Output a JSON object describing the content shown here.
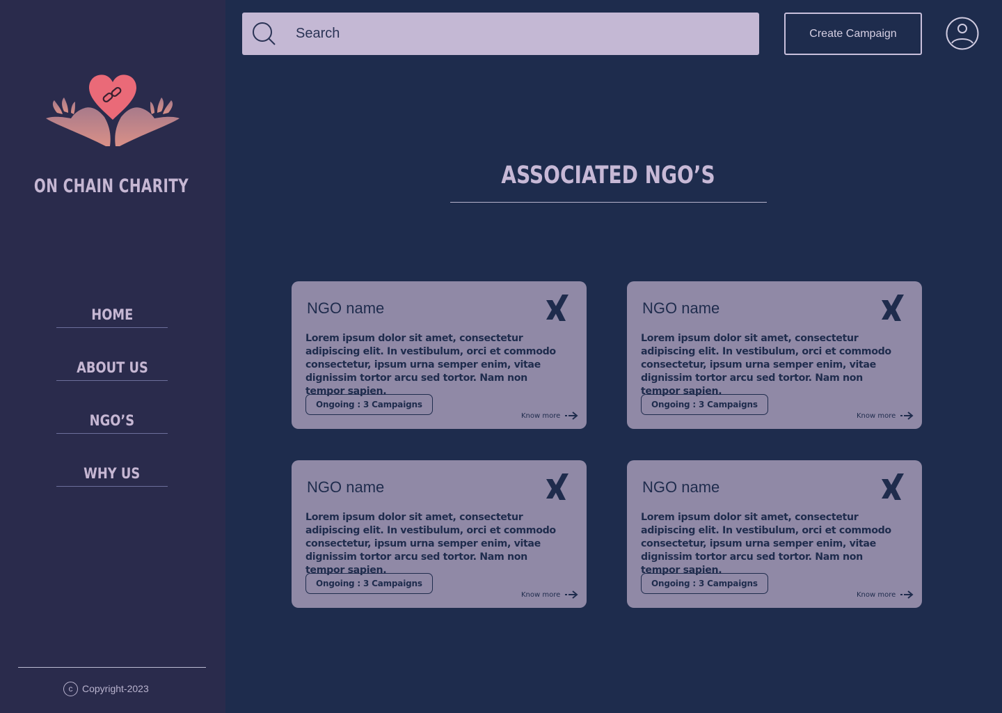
{
  "brand": {
    "name": "ON CHAIN CHARITY"
  },
  "nav": [
    {
      "label": "HOME"
    },
    {
      "label": "ABOUT US"
    },
    {
      "label": "NGO’S"
    },
    {
      "label": "WHY US"
    }
  ],
  "footer": {
    "copyright": "Copyright-2023",
    "copy_symbol": "c"
  },
  "search": {
    "placeholder": "Search"
  },
  "header": {
    "create_label": "Create Campaign"
  },
  "section": {
    "title": "ASSOCIATED NGO’S"
  },
  "cards": [
    {
      "name": "NGO name",
      "description": "Lorem ipsum dolor sit amet, consectetur adipiscing elit. In vestibulum, orci et commodo consectetur, ipsum urna semper enim, vitae dignissim tortor arcu sed tortor. Nam non tempor sapien.",
      "badge": "Ongoing : 3 Campaigns",
      "link": "Know more"
    },
    {
      "name": "NGO name",
      "description": "Lorem ipsum dolor sit amet, consectetur adipiscing elit. In vestibulum, orci et commodo consectetur, ipsum urna semper enim, vitae dignissim tortor arcu sed tortor. Nam non tempor sapien.",
      "badge": "Ongoing : 3 Campaigns",
      "link": "Know more"
    },
    {
      "name": "NGO name",
      "description": "Lorem ipsum dolor sit amet, consectetur adipiscing elit. In vestibulum, orci et commodo consectetur, ipsum urna semper enim, vitae dignissim tortor arcu sed tortor. Nam non tempor sapien.",
      "badge": "Ongoing : 3 Campaigns",
      "link": "Know more"
    },
    {
      "name": "NGO name",
      "description": "Lorem ipsum dolor sit amet, consectetur adipiscing elit. In vestibulum, orci et commodo consectetur, ipsum urna semper enim, vitae dignissim tortor arcu sed tortor. Nam non tempor sapien.",
      "badge": "Ongoing : 3 Campaigns",
      "link": "Know more"
    }
  ],
  "colors": {
    "background": "#1e2c4d",
    "sidebar": "#2a2b4c",
    "card": "#9089a6",
    "search": "#c4b8d4",
    "accent_heart": "#ea6a78",
    "hands": "#c98a8c"
  }
}
